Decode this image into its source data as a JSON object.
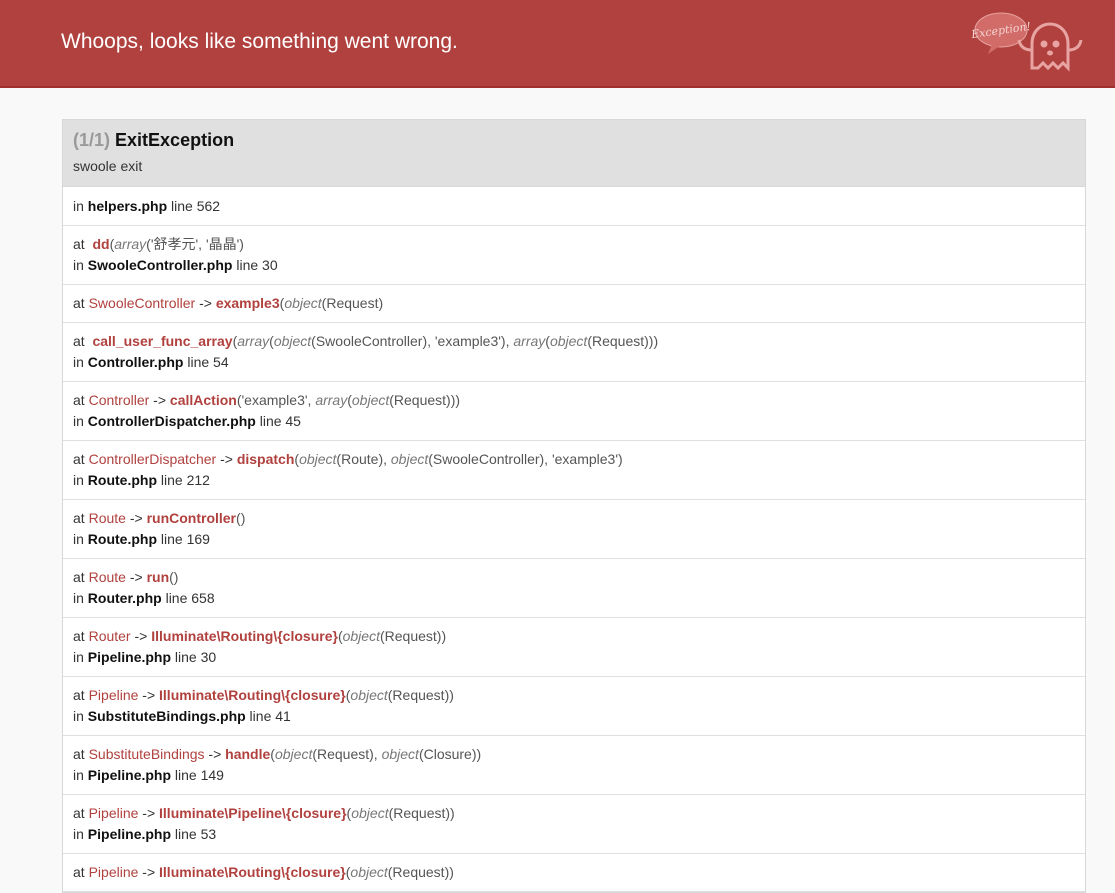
{
  "header": {
    "title": "Whoops, looks like something went wrong."
  },
  "logo": {
    "bubble_text": "Exception!"
  },
  "exception": {
    "count": "(1/1)",
    "name": "ExitException",
    "message": "swoole exit"
  },
  "colors": {
    "header_bg": "#b0413e",
    "accent": "#b0413e"
  },
  "frames": [
    {
      "at": "",
      "class": "",
      "function": "",
      "args": "",
      "file": "helpers.php",
      "line": "562"
    },
    {
      "at": "at",
      "class": "",
      "function": "dd",
      "args_html": [
        [
          "i",
          "array"
        ],
        [
          "t",
          "('舒孝元', '晶晶')"
        ]
      ],
      "file": "SwooleController.php",
      "line": "30"
    },
    {
      "at": "at",
      "class": "SwooleController",
      "function": "example3",
      "args_html": [
        [
          "i",
          "object"
        ],
        [
          "t",
          "(Request)"
        ]
      ],
      "file": "",
      "line": ""
    },
    {
      "at": "at",
      "class": "",
      "function": "call_user_func_array",
      "args_html": [
        [
          "i",
          "array"
        ],
        [
          "t",
          "("
        ],
        [
          "i",
          "object"
        ],
        [
          "t",
          "(SwooleController), 'example3'), "
        ],
        [
          "i",
          "array"
        ],
        [
          "t",
          "("
        ],
        [
          "i",
          "object"
        ],
        [
          "t",
          "(Request)))"
        ]
      ],
      "file": "Controller.php",
      "line": "54"
    },
    {
      "at": "at",
      "class": "Controller",
      "function": "callAction",
      "args_html": [
        [
          "t",
          "'example3', "
        ],
        [
          "i",
          "array"
        ],
        [
          "t",
          "("
        ],
        [
          "i",
          "object"
        ],
        [
          "t",
          "(Request)))"
        ]
      ],
      "file": "ControllerDispatcher.php",
      "line": "45"
    },
    {
      "at": "at",
      "class": "ControllerDispatcher",
      "function": "dispatch",
      "args_html": [
        [
          "i",
          "object"
        ],
        [
          "t",
          "(Route), "
        ],
        [
          "i",
          "object"
        ],
        [
          "t",
          "(SwooleController), 'example3')"
        ]
      ],
      "file": "Route.php",
      "line": "212"
    },
    {
      "at": "at",
      "class": "Route",
      "function": "runController",
      "args_html": [
        [
          "t",
          ")"
        ]
      ],
      "file": "Route.php",
      "line": "169"
    },
    {
      "at": "at",
      "class": "Route",
      "function": "run",
      "args_html": [
        [
          "t",
          ")"
        ]
      ],
      "file": "Router.php",
      "line": "658"
    },
    {
      "at": "at",
      "class": "Router",
      "function": "Illuminate\\Routing\\{closure}",
      "args_html": [
        [
          "i",
          "object"
        ],
        [
          "t",
          "(Request))"
        ]
      ],
      "file": "Pipeline.php",
      "line": "30"
    },
    {
      "at": "at",
      "class": "Pipeline",
      "function": "Illuminate\\Routing\\{closure}",
      "args_html": [
        [
          "i",
          "object"
        ],
        [
          "t",
          "(Request))"
        ]
      ],
      "file": "SubstituteBindings.php",
      "line": "41"
    },
    {
      "at": "at",
      "class": "SubstituteBindings",
      "function": "handle",
      "args_html": [
        [
          "i",
          "object"
        ],
        [
          "t",
          "(Request), "
        ],
        [
          "i",
          "object"
        ],
        [
          "t",
          "(Closure))"
        ]
      ],
      "file": "Pipeline.php",
      "line": "149"
    },
    {
      "at": "at",
      "class": "Pipeline",
      "function": "Illuminate\\Pipeline\\{closure}",
      "args_html": [
        [
          "i",
          "object"
        ],
        [
          "t",
          "(Request))"
        ]
      ],
      "file": "Pipeline.php",
      "line": "53"
    },
    {
      "at": "at",
      "class": "Pipeline",
      "function": "Illuminate\\Routing\\{closure}",
      "args_html": [
        [
          "i",
          "object"
        ],
        [
          "t",
          "(Request))"
        ]
      ],
      "file": "",
      "line": ""
    }
  ],
  "labels": {
    "in": "in",
    "line": "line",
    "arrow": "->"
  }
}
